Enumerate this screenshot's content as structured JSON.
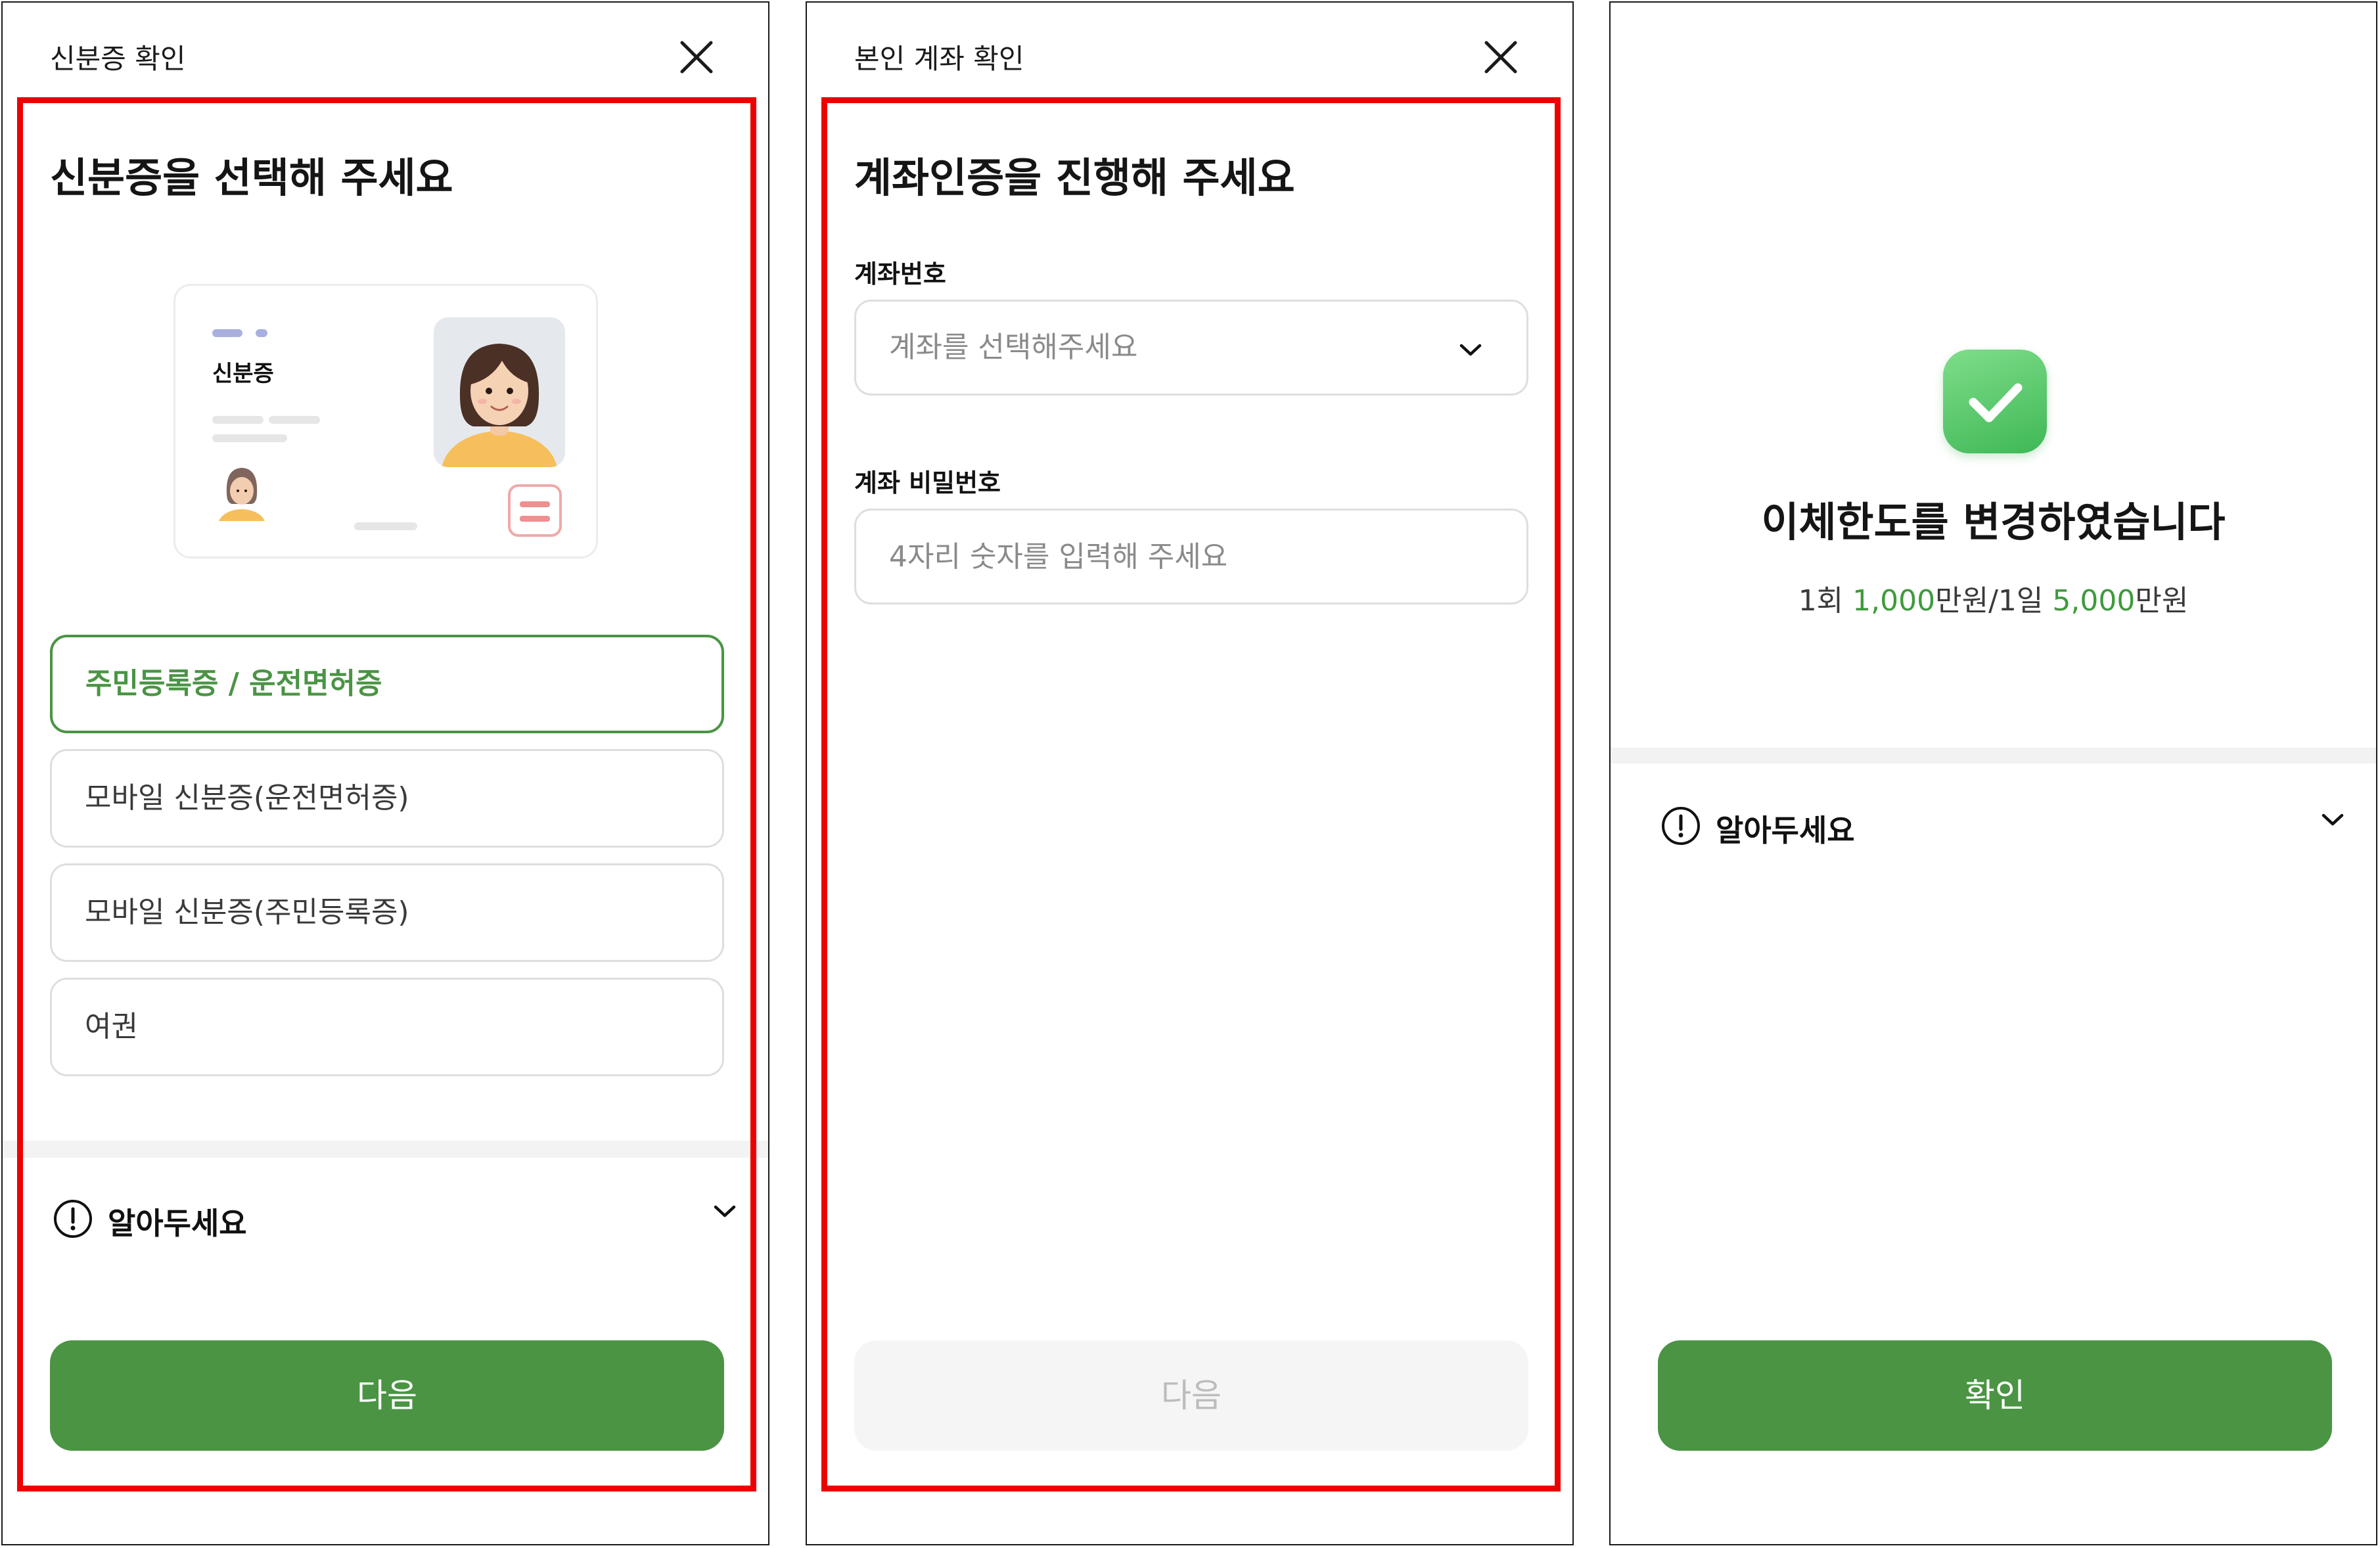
{
  "panel1": {
    "title": "신분증 확인",
    "heading": "신분증을 선택해 주세요",
    "card_label": "신분증",
    "options": [
      {
        "label": "주민등록증 / 운전면허증",
        "selected": true
      },
      {
        "label": "모바일 신분증(운전면허증)",
        "selected": false
      },
      {
        "label": "모바일 신분증(주민등록증)",
        "selected": false
      },
      {
        "label": "여권",
        "selected": false
      }
    ],
    "notice": "알아두세요",
    "next_button": "다음"
  },
  "panel2": {
    "title": "본인 계좌 확인",
    "heading": "계좌인증을 진행해 주세요",
    "account_number_label": "계좌번호",
    "account_select_placeholder": "계좌를 선택해주세요",
    "password_label": "계좌 비밀번호",
    "password_placeholder": "4자리 숫자를 입력해 주세요",
    "next_button": "다음"
  },
  "panel3": {
    "done_title": "이체한도를 변경하였습니다",
    "limit": {
      "once_prefix": "1회 ",
      "once_amount": "1,000",
      "once_unit": "만원/1일 ",
      "daily_amount": "5,000",
      "daily_unit": "만원"
    },
    "notice": "알아두세요",
    "confirm_button": "확인"
  },
  "colors": {
    "accent_green": "#4a9444",
    "highlight_red": "#ec0000",
    "check_green": "#4fc463"
  },
  "icons": [
    "close-icon",
    "chevron-down-icon",
    "exclamation-circle-icon",
    "check-icon"
  ]
}
